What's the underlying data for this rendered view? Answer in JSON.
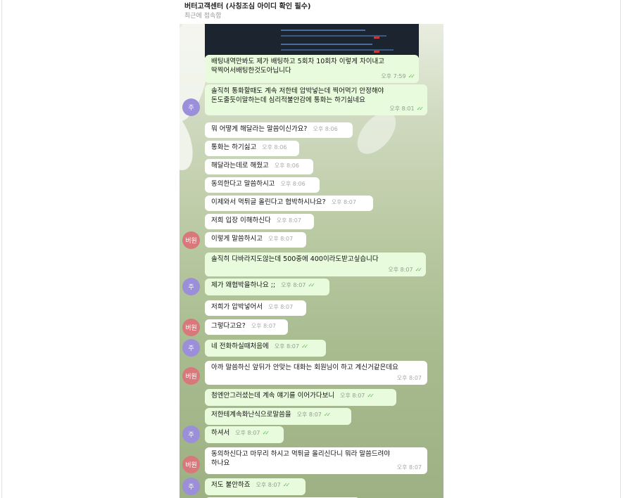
{
  "header": {
    "title": "버터고객센터 (사칭조심 아이디 확인 필수)",
    "status": "최근에 접속함"
  },
  "avatars": {
    "ju": "주",
    "bw": "버원"
  },
  "messages": [
    {
      "text": "배팅내역만봐도 제가 배팅하고 5회차 10회차 이렇게 차이내고\n딱찍어서배팅한것도아닙니다",
      "time": "오후 7:59",
      "dir": "out"
    },
    {
      "text": "솔직히 통화할때도 계속 저한테 압박넣는데 찍어먹기 안정해야\n돈도줄듯이말하는데 심리적불안감에 통화는 하기싫네요",
      "time": "오후 8:01",
      "dir": "out"
    },
    {
      "text": "뭐 어떻게 해달라는 말씀이신가요?",
      "time": "오후 8:06",
      "dir": "in"
    },
    {
      "text": "통화는 하기싫고",
      "time": "오후 8:06",
      "dir": "in"
    },
    {
      "text": "해달라는데로 해줬고",
      "time": "오후 8:06",
      "dir": "in"
    },
    {
      "text": "동의한다고 말씀하시고",
      "time": "오후 8:06",
      "dir": "in"
    },
    {
      "text": "이제와서 먹튀글 올린다고 협박하시나요?",
      "time": "오후 8:07",
      "dir": "in"
    },
    {
      "text": "저희 입장 이해하신다",
      "time": "오후 8:07",
      "dir": "in"
    },
    {
      "text": "이렇게 말씀하시고",
      "time": "오후 8:07",
      "dir": "in"
    },
    {
      "text": "솔직히 다바라지도않는데 500중에 400이라도받고싶습니다",
      "time": "오후 8:07",
      "dir": "out"
    },
    {
      "text": "제가 왜협박을하나요 ;;",
      "time": "오후 8:07",
      "dir": "out"
    },
    {
      "text": "저희가 압박넣어서",
      "time": "오후 8:07",
      "dir": "in"
    },
    {
      "text": "그렇다고요?",
      "time": "오후 8:07",
      "dir": "in"
    },
    {
      "text": "네 전화하실때처음에",
      "time": "오후 8:07",
      "dir": "out"
    },
    {
      "text": "아까 말씀하신 앞뒤가 안맞는 대화는 회원님이 하고 계신거같은데요",
      "time": "오후 8:07",
      "dir": "in"
    },
    {
      "text": "첨엔안그러셨는데 계속 얘기를 이어가다보니",
      "time": "오후 8:07",
      "dir": "out"
    },
    {
      "text": "저한테계속화난식으로말씀을",
      "time": "오후 8:07",
      "dir": "out"
    },
    {
      "text": "하셔서",
      "time": "오후 8:07",
      "dir": "out"
    },
    {
      "text": "동의하신다고 마무리 하시고 먹튀글 올리신다니 뭐라 말씀드려야\n하나요",
      "time": "오후 8:07",
      "dir": "in"
    },
    {
      "text": "저도 불안하죠",
      "time": "오후 8:07",
      "dir": "out"
    }
  ]
}
